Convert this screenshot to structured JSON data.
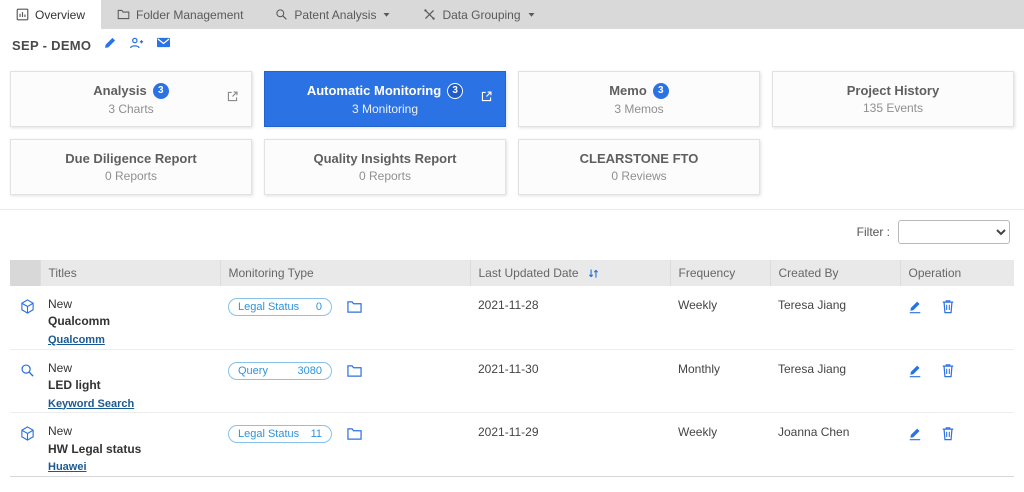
{
  "tabs": [
    {
      "label": "Overview",
      "icon": "overview-icon",
      "active": true
    },
    {
      "label": "Folder Management",
      "icon": "folder-icon",
      "active": false
    },
    {
      "label": "Patent Analysis",
      "icon": "patent-analysis-icon",
      "dropdown": true
    },
    {
      "label": "Data Grouping",
      "icon": "data-grouping-icon",
      "dropdown": true
    }
  ],
  "project": {
    "name": "SEP - DEMO",
    "icons": [
      "edit-icon",
      "add-user-icon",
      "mail-icon"
    ]
  },
  "cards": [
    {
      "title": "Analysis",
      "badge": "3",
      "subtitle": "3 Charts"
    },
    {
      "title": "Automatic Monitoring",
      "badge": "3",
      "subtitle": "3 Monitoring",
      "active": true
    },
    {
      "title": "Memo",
      "badge": "3",
      "subtitle": "3 Memos"
    },
    {
      "title": "Project History",
      "subtitle": "135 Events"
    },
    {
      "title": "Due Diligence Report",
      "subtitle": "0 Reports"
    },
    {
      "title": "Quality Insights Report",
      "subtitle": "0 Reports"
    },
    {
      "title": "CLEARSTONE FTO",
      "subtitle": "0 Reviews"
    }
  ],
  "filter": {
    "label": "Filter :"
  },
  "table": {
    "headers": [
      "Titles",
      "Monitoring Type",
      "Last Updated Date",
      "Frequency",
      "Created By",
      "Operation"
    ],
    "rows": [
      {
        "icon": "cube-icon",
        "line1": "New",
        "line2": "Qualcomm",
        "link": "Qualcomm",
        "type_label": "Legal Status",
        "type_count": "0",
        "date": "2021-11-28",
        "frequency": "Weekly",
        "created_by": "Teresa Jiang"
      },
      {
        "icon": "search-icon",
        "line1": "New",
        "line2": "LED light",
        "link": "Keyword Search",
        "type_label": "Query",
        "type_count": "3080",
        "date": "2021-11-30",
        "frequency": "Monthly",
        "created_by": "Teresa Jiang"
      },
      {
        "icon": "cube-icon",
        "line1": "New",
        "line2": "HW Legal status",
        "link": "Huawei",
        "type_label": "Legal Status",
        "type_count": "11",
        "date": "2021-11-29",
        "frequency": "Weekly",
        "created_by": "Joanna Chen"
      }
    ]
  },
  "colors": {
    "accent": "#2b72e4",
    "pill_blue": "#2e93dc",
    "tabbar_bg": "#d9d9d9"
  }
}
